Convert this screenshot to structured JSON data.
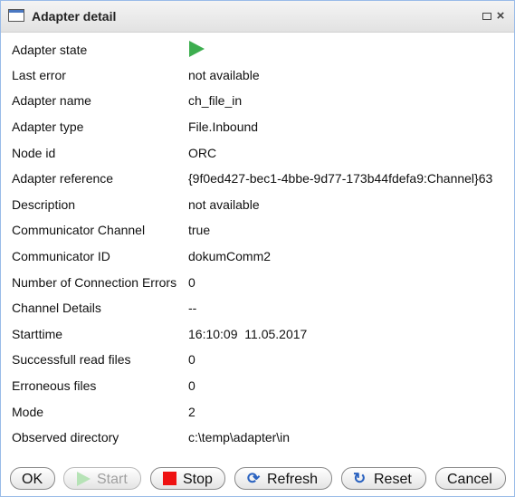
{
  "window": {
    "title": "Adapter detail",
    "icon": "window-icon",
    "controls": {
      "minimize": "minimize-icon",
      "close": "×"
    }
  },
  "details": [
    {
      "label": "Adapter state",
      "value": "",
      "icon": "play-icon",
      "icon_color": "#3dae4f"
    },
    {
      "label": "Last error",
      "value": "not available"
    },
    {
      "label": "Adapter name",
      "value": "ch_file_in"
    },
    {
      "label": "Adapter type",
      "value": "File.Inbound"
    },
    {
      "label": "Node id",
      "value": "ORC"
    },
    {
      "label": "Adapter reference",
      "value": "{9f0ed427-bec1-4bbe-9d77-173b44fdefa9:Channel}63"
    },
    {
      "label": "Description",
      "value": "not available"
    },
    {
      "label": "Communicator Channel",
      "value": "true"
    },
    {
      "label": "Communicator ID",
      "value": "dokumComm2"
    },
    {
      "label": "Number of Connection Errors",
      "value": "0"
    },
    {
      "label": "Channel Details",
      "value": "--"
    },
    {
      "label": "Starttime",
      "value": "16:10:09  11.05.2017"
    },
    {
      "label": "Successfull read files",
      "value": "0"
    },
    {
      "label": "Erroneous files",
      "value": "0"
    },
    {
      "label": "Mode",
      "value": "2"
    },
    {
      "label": "Observed directory",
      "value": "c:\\temp\\adapter\\in"
    }
  ],
  "buttons": {
    "ok": "OK",
    "start": "Start",
    "stop": "Stop",
    "refresh": "Refresh",
    "reset": "Reset",
    "cancel": "Cancel"
  },
  "colors": {
    "accent": "#2a62c0",
    "stop": "#ee1111",
    "start_disabled": "#b6e3b6"
  }
}
